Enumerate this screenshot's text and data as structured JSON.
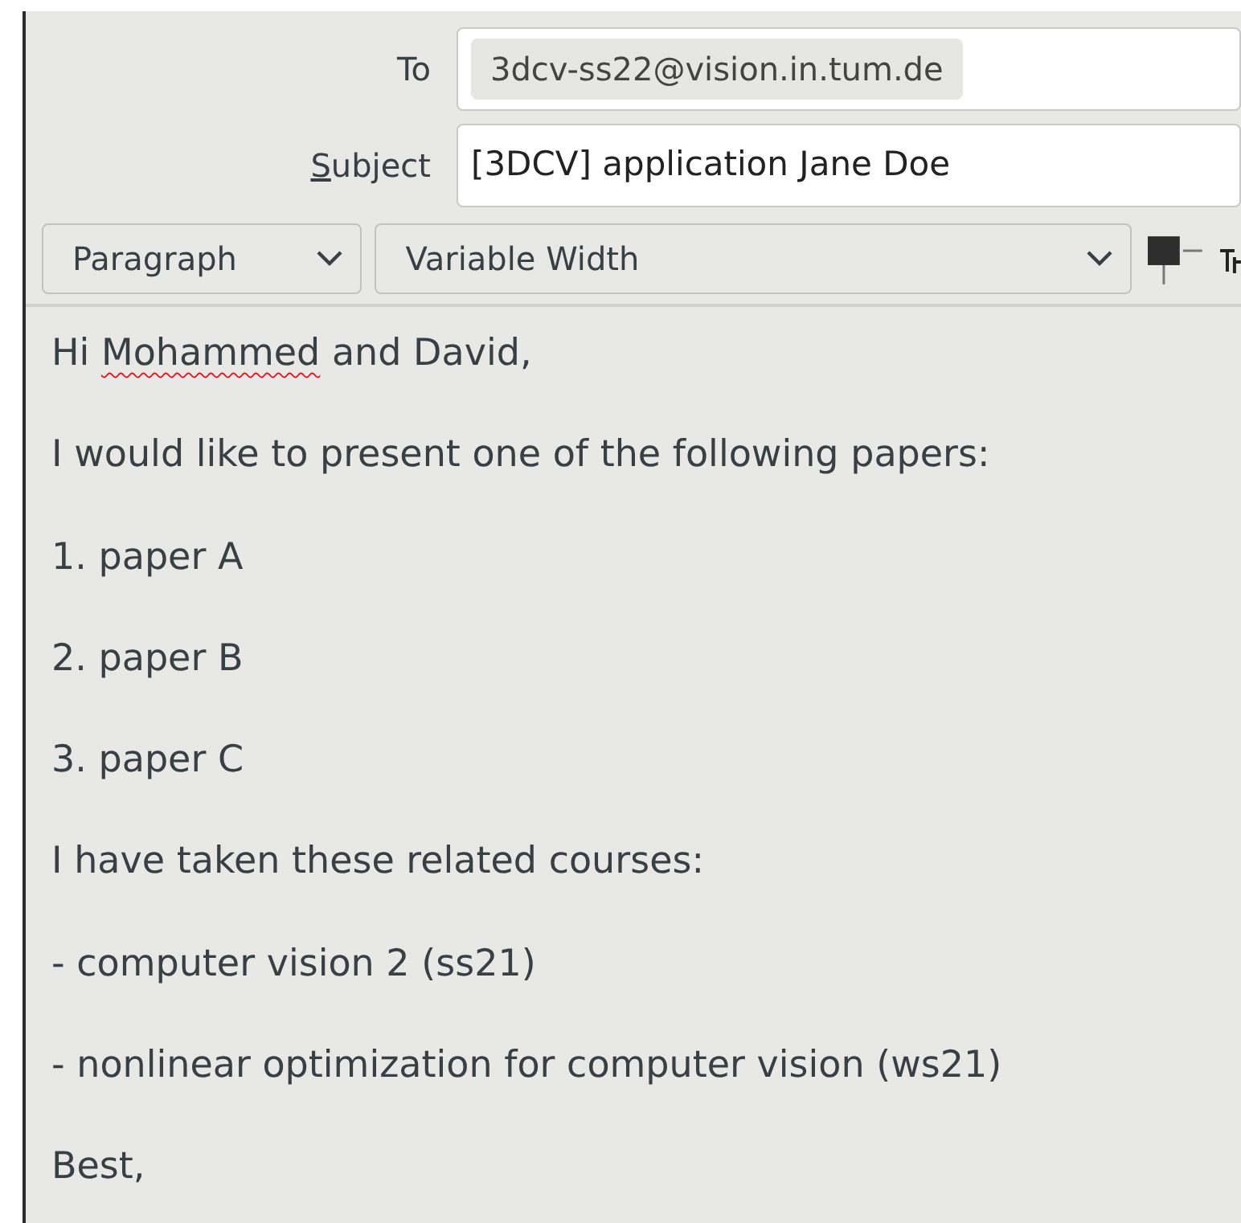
{
  "header": {
    "to": {
      "label": "To",
      "recipients": [
        "3dcv-ss22@vision.in.tum.de"
      ]
    },
    "subject": {
      "label": "Subject",
      "mnemonic_underlined": true,
      "value": "[3DCV] application Jane Doe"
    }
  },
  "toolbar": {
    "dropdowns": [
      {
        "kind": "short",
        "value": "Paragraph"
      },
      {
        "kind": "wide",
        "value": "Variable Width"
      }
    ]
  },
  "body": {
    "lines": [
      {
        "segments": [
          {
            "text": "Hi ",
            "misspelled": false
          },
          {
            "text": "Mohammed",
            "misspelled": true
          },
          {
            "text": " and David,",
            "misspelled": false
          }
        ]
      },
      {
        "segments": [
          {
            "text": "I would like to present one of the following papers:",
            "misspelled": false
          }
        ]
      },
      {
        "segments": [
          {
            "text": "1. paper A",
            "misspelled": false
          }
        ]
      },
      {
        "segments": [
          {
            "text": "2. paper B",
            "misspelled": false
          }
        ]
      },
      {
        "segments": [
          {
            "text": "3. paper C",
            "misspelled": false
          }
        ]
      },
      {
        "segments": [
          {
            "text": "I have taken these related courses:",
            "misspelled": false
          }
        ]
      },
      {
        "segments": [
          {
            "text": "- computer vision 2 (ss21)",
            "misspelled": false
          }
        ]
      },
      {
        "segments": [
          {
            "text": "- nonlinear optimization for computer vision (ws21)",
            "misspelled": false
          }
        ]
      },
      {
        "segments": [
          {
            "text": "Best,",
            "misspelled": false
          }
        ]
      }
    ]
  }
}
